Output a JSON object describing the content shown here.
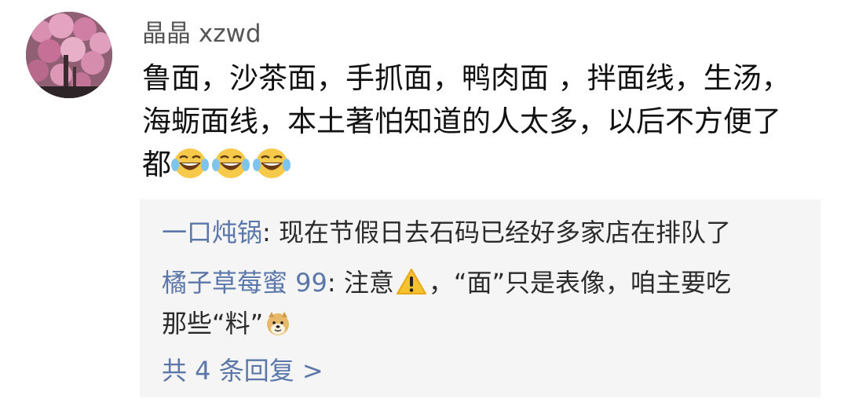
{
  "comment": {
    "username": "晶晶 xzwd",
    "lines": [
      "鲁面，沙茶面，手抓面，鸭肉面 ，拌面线，生汤，",
      "海蛎面线，本土著怕知道的人太多，以后不方便了",
      "都"
    ],
    "emojis": [
      "laughing-crying-emoji",
      "laughing-crying-emoji",
      "laughing-crying-emoji"
    ]
  },
  "replies": [
    {
      "author": "一口炖锅",
      "text": ": 现在节假日去石码已经好多家店在排队了"
    },
    {
      "author": "橘子草莓蜜 99",
      "text_before_icon": ": 注意",
      "icon": "warning-icon",
      "text_after_icon": "，“面”只是表像，咱主要吃",
      "text_line2": "那些“料”",
      "emoji": "doge-emoji"
    }
  ],
  "more_replies": "共 4 条回复 >",
  "colors": {
    "link": "#5b77a9",
    "reply_bg": "#f5f5f5",
    "username": "#555555"
  }
}
